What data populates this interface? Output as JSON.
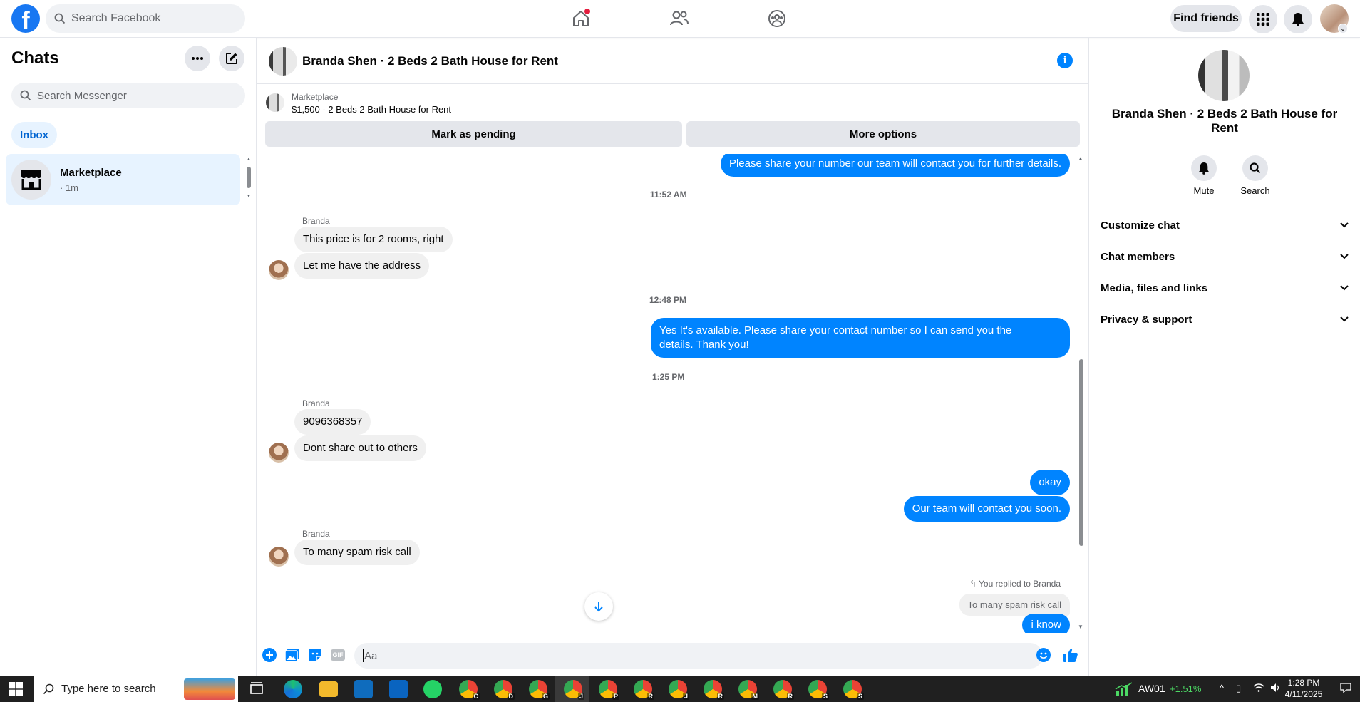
{
  "topnav": {
    "logo_letter": "f",
    "search_placeholder": "Search Facebook",
    "find_friends": "Find friends"
  },
  "sidebar": {
    "title": "Chats",
    "search_placeholder": "Search Messenger",
    "inbox_label": "Inbox",
    "conversations": [
      {
        "name": "Marketplace",
        "time": "· 1m"
      }
    ]
  },
  "conversation": {
    "title": "Branda Shen · 2 Beds 2 Bath House for Rent",
    "marketplace_label": "Marketplace",
    "listing": "$1,500 - 2 Beds 2 Bath House for Rent",
    "mark_pending": "Mark as pending",
    "more_options": "More options",
    "messages": {
      "out_top": "Please share your number our team will contact you for further details.",
      "ts1": "11:52 AM",
      "sender1": "Branda",
      "in1": "This price is for 2 rooms, right",
      "in2": "Let me have the address",
      "ts2": "12:48 PM",
      "out2": "Yes It's available. Please share your contact number so I can send you the details. Thank you!",
      "ts3": "1:25 PM",
      "sender2": "Branda",
      "in3": "9096368357",
      "in4": "Dont share out to others",
      "out3": "okay",
      "out4": "Our team will contact you soon.",
      "sender3": "Branda",
      "in5": "To many spam risk call",
      "reply_note": "You replied to Branda",
      "reply_quote": "To many spam risk call",
      "out5": "i know"
    },
    "composer_placeholder": "Aa",
    "gif_label": "GIF"
  },
  "right_panel": {
    "name": "Branda Shen · 2 Beds 2 Bath House for Rent",
    "actions": [
      "Mute",
      "Search"
    ],
    "sections": [
      "Customize chat",
      "Chat members",
      "Media, files and links",
      "Privacy & support"
    ]
  },
  "taskbar": {
    "search_placeholder": "Type here to search",
    "app_letters": [
      "C",
      "D",
      "G",
      "J",
      "P",
      "R",
      "J",
      "R",
      "M",
      "R",
      "S",
      "S"
    ],
    "stock_name": "AW01",
    "stock_change": "+1.51%",
    "time": "1:28 PM",
    "date": "4/11/2025"
  },
  "colors": {
    "brand_blue": "#1877f2",
    "messenger_blue": "#0084ff",
    "notification_red": "#e41e3f"
  }
}
